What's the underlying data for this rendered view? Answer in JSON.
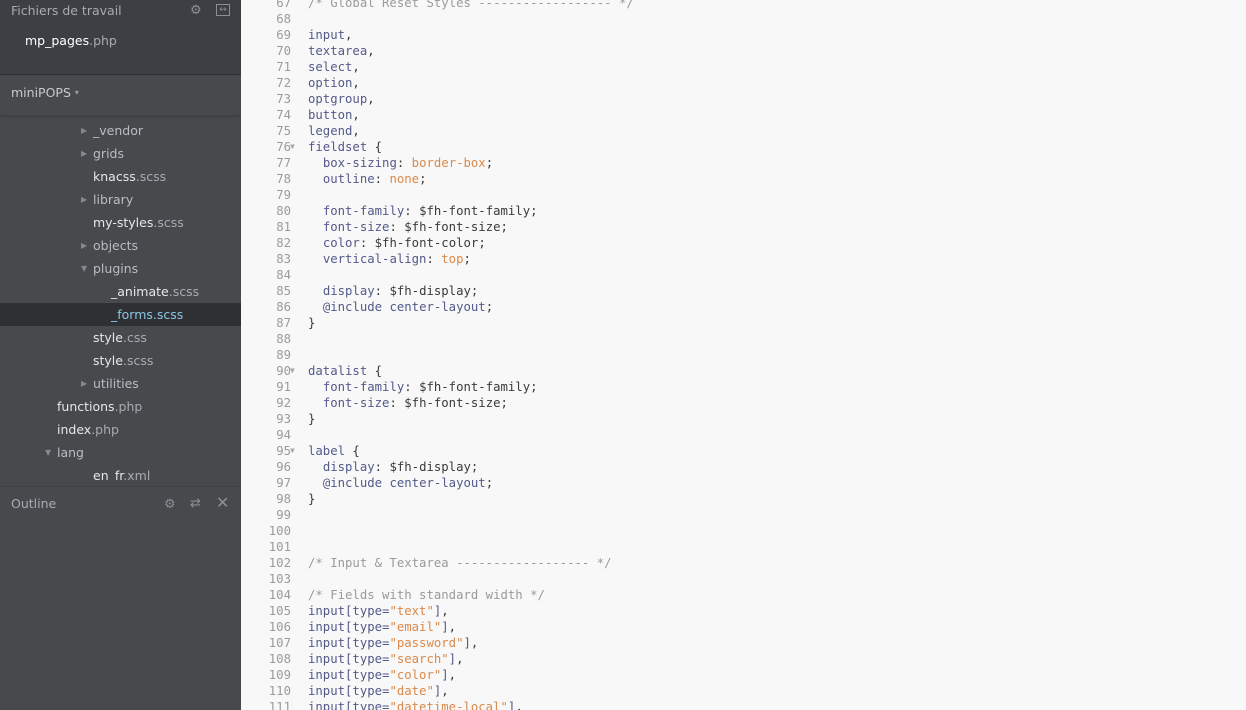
{
  "sidebar": {
    "working_files": {
      "title": "Fichiers de travail",
      "icons": [
        "gear-icon",
        "split-view-icon"
      ],
      "files": [
        {
          "name": "mp_pages",
          "ext": ".php"
        }
      ]
    },
    "project": {
      "name": "miniPOPS",
      "caret": "▾"
    },
    "tree": [
      {
        "type": "folder",
        "name": "_vendor",
        "ext": "",
        "expanded": false,
        "depth": 2
      },
      {
        "type": "folder",
        "name": "grids",
        "ext": "",
        "expanded": false,
        "depth": 2
      },
      {
        "type": "file",
        "name": "knacss",
        "ext": ".scss",
        "depth": 2
      },
      {
        "type": "folder",
        "name": "library",
        "ext": "",
        "expanded": false,
        "depth": 2
      },
      {
        "type": "file",
        "name": "my-styles",
        "ext": ".scss",
        "depth": 2
      },
      {
        "type": "folder",
        "name": "objects",
        "ext": "",
        "expanded": false,
        "depth": 2
      },
      {
        "type": "folder",
        "name": "plugins",
        "ext": "",
        "expanded": true,
        "depth": 2
      },
      {
        "type": "file",
        "name": "_animate",
        "ext": ".scss",
        "depth": 3
      },
      {
        "type": "file",
        "name": "_forms",
        "ext": ".scss",
        "depth": 3,
        "selected": true
      },
      {
        "type": "file",
        "name": "style",
        "ext": ".css",
        "depth": 2
      },
      {
        "type": "file",
        "name": "style",
        "ext": ".scss",
        "depth": 2
      },
      {
        "type": "folder",
        "name": "utilities",
        "ext": "",
        "expanded": false,
        "depth": 2
      },
      {
        "type": "file",
        "name": "functions",
        "ext": ".php",
        "depth": 1
      },
      {
        "type": "file",
        "name": "index",
        "ext": ".php",
        "depth": 1
      },
      {
        "type": "folder",
        "name": "lang",
        "ext": "",
        "expanded": true,
        "depth": 1
      },
      {
        "type": "file",
        "name": "en_fr",
        "ext": ".xml",
        "depth": 2
      }
    ],
    "outline": {
      "title": "Outline",
      "icons": [
        "gear-icon",
        "swap-icon",
        "close-icon"
      ]
    }
  },
  "editor": {
    "colors": {
      "background": "#f8f8f8",
      "comment": "#9a9a9a",
      "keyword": "#535a8a",
      "value": "#d9894a"
    },
    "lines": [
      {
        "n": 67,
        "tokens": [
          [
            "comment",
            "/* Global Reset Styles ------------------ */"
          ]
        ]
      },
      {
        "n": 68,
        "tokens": []
      },
      {
        "n": 69,
        "tokens": [
          [
            "sel",
            "input"
          ],
          [
            "punc",
            ","
          ]
        ]
      },
      {
        "n": 70,
        "tokens": [
          [
            "sel",
            "textarea"
          ],
          [
            "punc",
            ","
          ]
        ]
      },
      {
        "n": 71,
        "tokens": [
          [
            "sel",
            "select"
          ],
          [
            "punc",
            ","
          ]
        ]
      },
      {
        "n": 72,
        "tokens": [
          [
            "sel",
            "option"
          ],
          [
            "punc",
            ","
          ]
        ]
      },
      {
        "n": 73,
        "tokens": [
          [
            "sel",
            "optgroup"
          ],
          [
            "punc",
            ","
          ]
        ]
      },
      {
        "n": 74,
        "tokens": [
          [
            "sel",
            "button"
          ],
          [
            "punc",
            ","
          ]
        ]
      },
      {
        "n": 75,
        "tokens": [
          [
            "sel",
            "legend"
          ],
          [
            "punc",
            ","
          ]
        ]
      },
      {
        "n": 76,
        "fold": true,
        "tokens": [
          [
            "sel",
            "fieldset"
          ],
          [
            "punc",
            " {"
          ]
        ]
      },
      {
        "n": 77,
        "tokens": [
          [
            "punc",
            "  "
          ],
          [
            "prop",
            "box-sizing"
          ],
          [
            "punc",
            ": "
          ],
          [
            "val",
            "border-box"
          ],
          [
            "punc",
            ";"
          ]
        ]
      },
      {
        "n": 78,
        "tokens": [
          [
            "punc",
            "  "
          ],
          [
            "prop",
            "outline"
          ],
          [
            "punc",
            ": "
          ],
          [
            "val",
            "none"
          ],
          [
            "punc",
            ";"
          ]
        ]
      },
      {
        "n": 79,
        "tokens": []
      },
      {
        "n": 80,
        "tokens": [
          [
            "punc",
            "  "
          ],
          [
            "prop",
            "font-family"
          ],
          [
            "punc",
            ": "
          ],
          [
            "var",
            "$fh-font-family"
          ],
          [
            "punc",
            ";"
          ]
        ]
      },
      {
        "n": 81,
        "tokens": [
          [
            "punc",
            "  "
          ],
          [
            "prop",
            "font-size"
          ],
          [
            "punc",
            ": "
          ],
          [
            "var",
            "$fh-font-size"
          ],
          [
            "punc",
            ";"
          ]
        ]
      },
      {
        "n": 82,
        "tokens": [
          [
            "punc",
            "  "
          ],
          [
            "prop",
            "color"
          ],
          [
            "punc",
            ": "
          ],
          [
            "var",
            "$fh-font-color"
          ],
          [
            "punc",
            ";"
          ]
        ]
      },
      {
        "n": 83,
        "tokens": [
          [
            "punc",
            "  "
          ],
          [
            "prop",
            "vertical-align"
          ],
          [
            "punc",
            ": "
          ],
          [
            "val",
            "top"
          ],
          [
            "punc",
            ";"
          ]
        ]
      },
      {
        "n": 84,
        "tokens": []
      },
      {
        "n": 85,
        "tokens": [
          [
            "punc",
            "  "
          ],
          [
            "prop",
            "display"
          ],
          [
            "punc",
            ": "
          ],
          [
            "var",
            "$fh-display"
          ],
          [
            "punc",
            ";"
          ]
        ]
      },
      {
        "n": 86,
        "tokens": [
          [
            "punc",
            "  "
          ],
          [
            "at",
            "@include"
          ],
          [
            "punc",
            " "
          ],
          [
            "sel",
            "center-layout"
          ],
          [
            "punc",
            ";"
          ]
        ]
      },
      {
        "n": 87,
        "tokens": [
          [
            "punc",
            "}"
          ]
        ]
      },
      {
        "n": 88,
        "tokens": []
      },
      {
        "n": 89,
        "tokens": []
      },
      {
        "n": 90,
        "fold": true,
        "tokens": [
          [
            "sel",
            "datalist"
          ],
          [
            "punc",
            " {"
          ]
        ]
      },
      {
        "n": 91,
        "tokens": [
          [
            "punc",
            "  "
          ],
          [
            "prop",
            "font-family"
          ],
          [
            "punc",
            ": "
          ],
          [
            "var",
            "$fh-font-family"
          ],
          [
            "punc",
            ";"
          ]
        ]
      },
      {
        "n": 92,
        "tokens": [
          [
            "punc",
            "  "
          ],
          [
            "prop",
            "font-size"
          ],
          [
            "punc",
            ": "
          ],
          [
            "var",
            "$fh-font-size"
          ],
          [
            "punc",
            ";"
          ]
        ]
      },
      {
        "n": 93,
        "tokens": [
          [
            "punc",
            "}"
          ]
        ]
      },
      {
        "n": 94,
        "tokens": []
      },
      {
        "n": 95,
        "fold": true,
        "tokens": [
          [
            "sel",
            "label"
          ],
          [
            "punc",
            " {"
          ]
        ]
      },
      {
        "n": 96,
        "tokens": [
          [
            "punc",
            "  "
          ],
          [
            "prop",
            "display"
          ],
          [
            "punc",
            ": "
          ],
          [
            "var",
            "$fh-display"
          ],
          [
            "punc",
            ";"
          ]
        ]
      },
      {
        "n": 97,
        "tokens": [
          [
            "punc",
            "  "
          ],
          [
            "at",
            "@include"
          ],
          [
            "punc",
            " "
          ],
          [
            "sel",
            "center-layout"
          ],
          [
            "punc",
            ";"
          ]
        ]
      },
      {
        "n": 98,
        "tokens": [
          [
            "punc",
            "}"
          ]
        ]
      },
      {
        "n": 99,
        "tokens": []
      },
      {
        "n": 100,
        "tokens": []
      },
      {
        "n": 101,
        "tokens": []
      },
      {
        "n": 102,
        "tokens": [
          [
            "comment",
            "/* Input & Textarea ------------------ */"
          ]
        ]
      },
      {
        "n": 103,
        "tokens": []
      },
      {
        "n": 104,
        "tokens": [
          [
            "comment",
            "/* Fields with standard width */"
          ]
        ]
      },
      {
        "n": 105,
        "tokens": [
          [
            "sel",
            "input[type="
          ],
          [
            "str",
            "\"text\""
          ],
          [
            "sel",
            "]"
          ],
          [
            "punc",
            ","
          ]
        ]
      },
      {
        "n": 106,
        "tokens": [
          [
            "sel",
            "input[type="
          ],
          [
            "str",
            "\"email\""
          ],
          [
            "sel",
            "]"
          ],
          [
            "punc",
            ","
          ]
        ]
      },
      {
        "n": 107,
        "tokens": [
          [
            "sel",
            "input[type="
          ],
          [
            "str",
            "\"password\""
          ],
          [
            "sel",
            "]"
          ],
          [
            "punc",
            ","
          ]
        ]
      },
      {
        "n": 108,
        "tokens": [
          [
            "sel",
            "input[type="
          ],
          [
            "str",
            "\"search\""
          ],
          [
            "sel",
            "]"
          ],
          [
            "punc",
            ","
          ]
        ]
      },
      {
        "n": 109,
        "tokens": [
          [
            "sel",
            "input[type="
          ],
          [
            "str",
            "\"color\""
          ],
          [
            "sel",
            "]"
          ],
          [
            "punc",
            ","
          ]
        ]
      },
      {
        "n": 110,
        "tokens": [
          [
            "sel",
            "input[type="
          ],
          [
            "str",
            "\"date\""
          ],
          [
            "sel",
            "]"
          ],
          [
            "punc",
            ","
          ]
        ]
      },
      {
        "n": 111,
        "tokens": [
          [
            "sel",
            "input[type="
          ],
          [
            "str",
            "\"datetime-local\""
          ],
          [
            "sel",
            "]"
          ],
          [
            "punc",
            ","
          ]
        ]
      }
    ]
  }
}
